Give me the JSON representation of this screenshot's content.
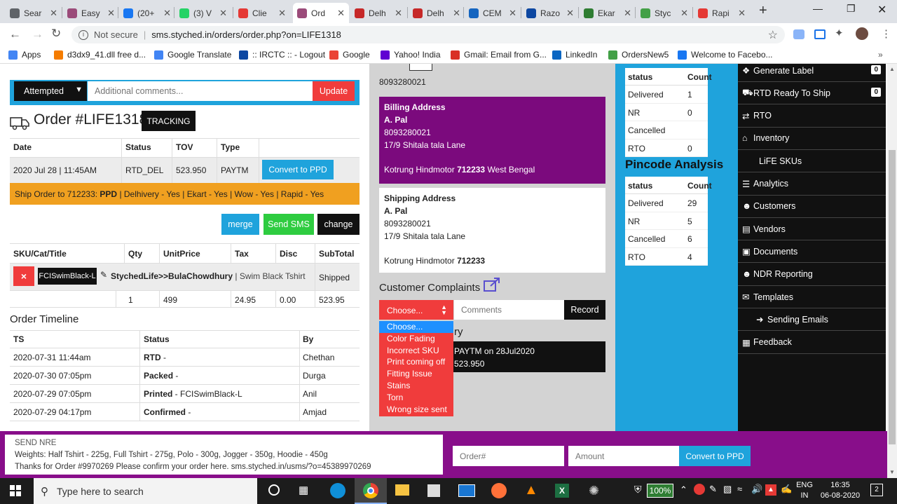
{
  "browser": {
    "tabs": [
      {
        "label": "Sear",
        "color": "#5f6368",
        "active": false
      },
      {
        "label": "Easy",
        "color": "#9b4b7a",
        "active": false
      },
      {
        "label": "(20+",
        "color": "#1877f2",
        "active": false
      },
      {
        "label": "(3) V",
        "color": "#25d366",
        "active": false
      },
      {
        "label": "Clie",
        "color": "#e53935",
        "active": false
      },
      {
        "label": "Ord",
        "color": "#9b4b7a",
        "active": true
      },
      {
        "label": "Delh",
        "color": "#c62828",
        "active": false
      },
      {
        "label": "Delh",
        "color": "#c62828",
        "active": false
      },
      {
        "label": "CEM",
        "color": "#1565c0",
        "active": false
      },
      {
        "label": "Razo",
        "color": "#0d47a1",
        "active": false
      },
      {
        "label": "Ekar",
        "color": "#2e7d32",
        "active": false
      },
      {
        "label": "Styc",
        "color": "#43a047",
        "active": false
      },
      {
        "label": "Rapi",
        "color": "#e53935",
        "active": false
      }
    ],
    "not_secure": "Not secure",
    "url": "sms.styched.in/orders/order.php?on=LIFE1318",
    "bookmarks": [
      {
        "label": "Apps",
        "color": "#4285f4"
      },
      {
        "label": "d3dx9_41.dll free d...",
        "color": "#f57c00"
      },
      {
        "label": "Google Translate",
        "color": "#4285f4"
      },
      {
        "label": ":: IRCTC :: - Logout",
        "color": "#0d47a1"
      },
      {
        "label": "Google",
        "color": "#ea4335"
      },
      {
        "label": "Yahoo! India",
        "color": "#6001d2"
      },
      {
        "label": "Gmail: Email from G...",
        "color": "#d93025"
      },
      {
        "label": "LinkedIn",
        "color": "#0a66c2"
      },
      {
        "label": "OrdersNew5",
        "color": "#43a047"
      },
      {
        "label": "Welcome to Facebo...",
        "color": "#1877f2"
      }
    ]
  },
  "top_status": {
    "value": "Attempted",
    "comments_placeholder": "Additional comments...",
    "update_label": "Update"
  },
  "order": {
    "title": "Order #LIFE1318",
    "tracking_label": "TRACKING",
    "headers": [
      "Date",
      "Status",
      "TOV",
      "Type"
    ],
    "date": "2020 Jul 28 | 11:45AM",
    "status": "RTD_DEL",
    "tov": "523.950",
    "type": "PAYTM",
    "convert_label": "Convert to PPD",
    "ship_prefix": "Ship Order to 712233: ",
    "ship_mode": "PPD",
    "ship_rest": " | Delhivery - Yes | Ekart - Yes | Wow - Yes | Rapid - Yes",
    "merge_label": "merge",
    "send_sms_label": "Send SMS",
    "change_label": "change"
  },
  "items": {
    "headers": [
      "SKU/Cat/Title",
      "Qty",
      "UnitPrice",
      "Tax",
      "Disc",
      "SubTotal"
    ],
    "remove_icon": "×",
    "sku": "FCISwimBlack-L",
    "title_bold": "StychedLife>>BulaChowdhury",
    "title_rest": " | Swim Black Tshirt",
    "item_status": "Shipped",
    "qty": "1",
    "unit_price": "499",
    "tax": "24.95",
    "disc": "0.00",
    "subtotal": "523.95"
  },
  "timeline": {
    "title": "Order Timeline",
    "headers": [
      "TS",
      "Status",
      "By"
    ],
    "rows": [
      {
        "ts": "2020-07-31 11:44am",
        "status": "RTD",
        "detail": " -",
        "by": "Chethan"
      },
      {
        "ts": "2020-07-30 07:05pm",
        "status": "Packed",
        "detail": " -",
        "by": "Durga"
      },
      {
        "ts": "2020-07-29 07:05pm",
        "status": "Printed",
        "detail": " - FCISwimBlack-L",
        "by": "Anil"
      },
      {
        "ts": "2020-07-29 04:17pm",
        "status": "Confirmed",
        "detail": " -",
        "by": "Amjad"
      }
    ]
  },
  "phone_top": "8093280021",
  "billing": {
    "title": "Billing Address",
    "name": "A. Pal",
    "phone": "8093280021",
    "line1": "17/9 Shitala tala Lane",
    "city": "Kotrung Hindmotor ",
    "pin": "712233",
    "state": " West Bengal"
  },
  "shipping": {
    "title": "Shipping Address",
    "name": "A. Pal",
    "phone": "8093280021",
    "line1": "17/9 Shitala tala Lane",
    "city": "Kotrung Hindmotor ",
    "pin": "712233"
  },
  "complaints": {
    "title": "Customer Complaints",
    "select_label": "Choose...",
    "comments_placeholder": "Comments",
    "record_label": "Record",
    "options": [
      "Choose...",
      "Color Fading",
      "Incorrect SKU",
      "Print coming off",
      "Fitting Issue",
      "Stains",
      "Torn",
      "Wrong size sent"
    ],
    "history_suffix": "ry",
    "payment_line1": "PAYTM on 28Jul2020",
    "payment_line2": "523.950"
  },
  "stats_top": {
    "headers": [
      "status",
      "Count"
    ],
    "rows": [
      [
        "Delivered",
        "1"
      ],
      [
        "NR",
        "0"
      ],
      [
        "Cancelled",
        ""
      ],
      [
        "RTO",
        "0"
      ]
    ]
  },
  "pincode": {
    "title": "Pincode Analysis",
    "headers": [
      "status",
      "Count"
    ],
    "rows": [
      [
        "Delivered",
        "29"
      ],
      [
        "NR",
        "5"
      ],
      [
        "Cancelled",
        "6"
      ],
      [
        "RTO",
        "4"
      ]
    ]
  },
  "nav": [
    {
      "label": "Generate Label",
      "badge": "0",
      "icon": "tag-icon"
    },
    {
      "label": "RTD Ready To Ship",
      "badge": "0",
      "icon": "truck-icon"
    },
    {
      "label": "RTO",
      "badge": "",
      "icon": "exchange-icon"
    },
    {
      "label": "Inventory",
      "badge": "",
      "icon": "home-icon"
    },
    {
      "label": "LiFE SKUs",
      "badge": "",
      "icon": ""
    },
    {
      "label": "Analytics",
      "badge": "",
      "icon": "barcode-icon"
    },
    {
      "label": "Customers",
      "badge": "",
      "icon": "user-icon"
    },
    {
      "label": "Vendors",
      "badge": "",
      "icon": "file-icon"
    },
    {
      "label": "Documents",
      "badge": "",
      "icon": "card-icon"
    },
    {
      "label": "NDR Reporting",
      "badge": "",
      "icon": "user-icon"
    },
    {
      "label": "Templates",
      "badge": "",
      "icon": "envelope-icon"
    },
    {
      "label": "Sending Emails",
      "badge": "",
      "icon": "arrow-right-icon"
    },
    {
      "label": "Feedback",
      "badge": "",
      "icon": "table-icon"
    }
  ],
  "bottom": {
    "nre_title": "SEND NRE",
    "weights": "Weights: Half Tshirt - 225g, Full Tshirt - 275g, Polo - 300g, Jogger - 350g, Hoodie - 450g",
    "thanks": "Thanks for Order #9970269 Please confirm your order here. sms.styched.in/usms/?o=45389970269",
    "order_placeholder": "Order#",
    "amount_placeholder": "Amount",
    "convert_label": "Convert to PPD"
  },
  "taskbar": {
    "search_placeholder": "Type here to search",
    "battery": "100%",
    "lang1": "ENG",
    "lang2": "IN",
    "time": "16:35",
    "date": "06-08-2020",
    "notif_count": "2"
  },
  "colors": {
    "blue": "#1fa3dc",
    "purple": "#7b0a7d",
    "red": "#f03c3c",
    "green": "#2ecc40",
    "orange": "#f0a020",
    "dark": "#111111"
  }
}
